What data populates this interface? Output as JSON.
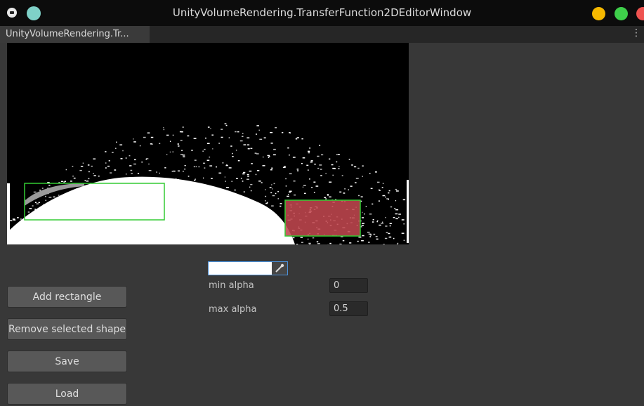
{
  "window": {
    "title": "UnityVolumeRendering.TransferFunction2DEditorWindow",
    "tab_label": "UnityVolumeRendering.Tr...",
    "controls": {
      "minimize": "#f5b800",
      "maximize": "#3ecf4a",
      "close": "#ef5350"
    }
  },
  "histogram": {
    "shapes": [
      {
        "name": "rectangle-1",
        "selected": false,
        "fill": "none",
        "outline": "#33cc33"
      },
      {
        "name": "rectangle-2",
        "selected": true,
        "fill": "#c0474e",
        "outline": "#33cc33"
      }
    ]
  },
  "color_field": {
    "value": "#ffffff",
    "picker_icon": "eyedropper-icon"
  },
  "fields": {
    "min_alpha": {
      "label": "min alpha",
      "value": "0"
    },
    "max_alpha": {
      "label": "max alpha",
      "value": "0.5"
    }
  },
  "buttons": {
    "add": "Add rectangle",
    "remove": "Remove selected shape",
    "save": "Save",
    "load": "Load"
  },
  "icons": {
    "app": "unity-icon",
    "menu": "kebab-menu-icon"
  }
}
